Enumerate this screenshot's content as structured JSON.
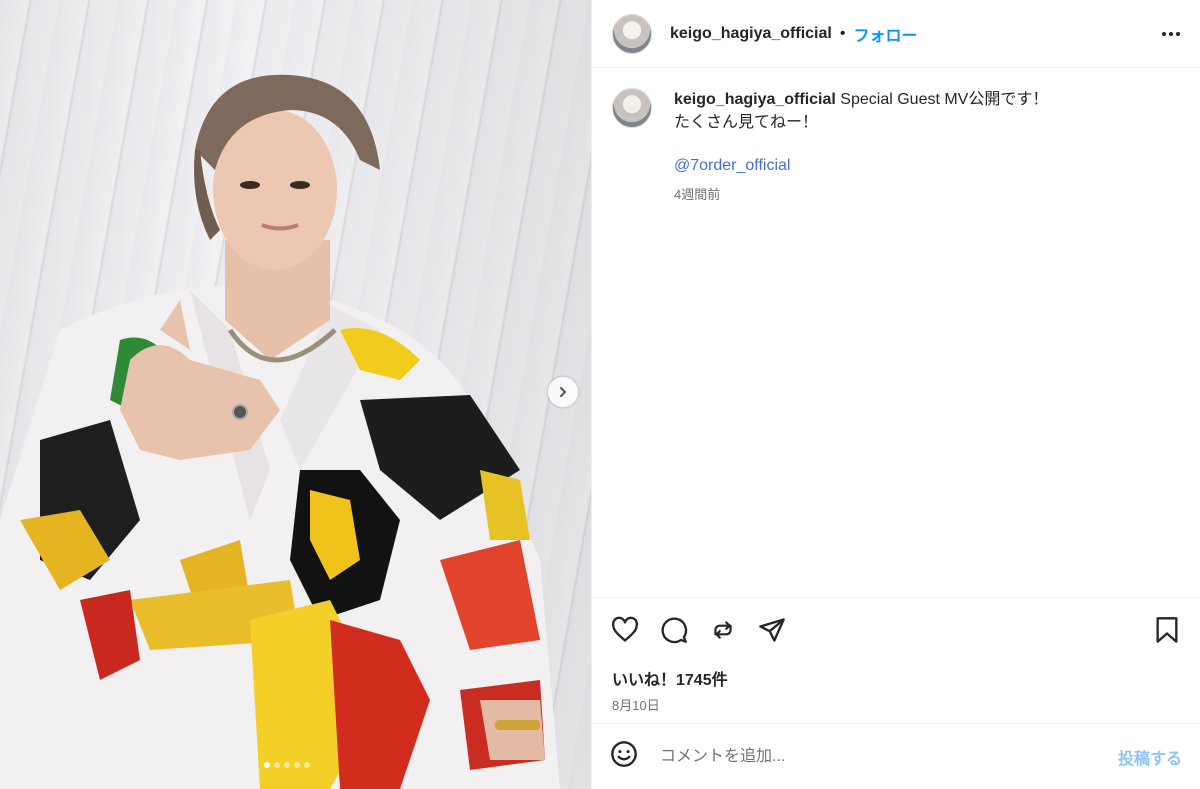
{
  "post": {
    "username": "keigo_hagiya_official",
    "bullet": "•",
    "follow_label": "フォロー",
    "caption_line1": "Special Guest MV公開です！",
    "caption_line2": "たくさん見てねー！",
    "mention": "@7order_official",
    "time_ago": "4週間前",
    "likes": "いいね！1745件",
    "date": "8月10日"
  },
  "comment": {
    "placeholder": "コメントを追加...",
    "post_label": "投稿する"
  },
  "media": {
    "photo": "man-in-patterned-shirt-photo",
    "slide_count": 5,
    "active_slide": 1
  },
  "colors": {
    "accent": "#0095f6",
    "mention": "#4a6fd4",
    "post_disabled": "#8fc3f7",
    "muted": "#737373"
  },
  "icons": [
    "heart-icon",
    "comment-icon",
    "repost-icon",
    "share-icon",
    "bookmark-icon",
    "emoji-icon",
    "more-options-icon",
    "chevron-right-icon"
  ]
}
